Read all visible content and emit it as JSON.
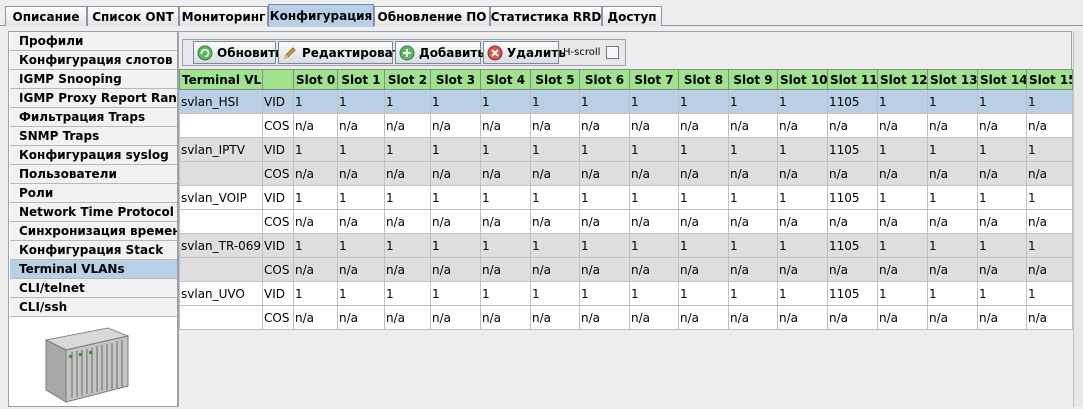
{
  "tabs": [
    {
      "label": "Описание",
      "active": false
    },
    {
      "label": "Список ONT",
      "active": false
    },
    {
      "label": "Мониторинг",
      "active": false
    },
    {
      "label": "Конфигурация",
      "active": true
    },
    {
      "label": "Обновление ПО",
      "active": false
    },
    {
      "label": "Статистика RRD",
      "active": false
    },
    {
      "label": "Доступ",
      "active": false
    }
  ],
  "sidebar": {
    "items": [
      {
        "label": "Профили"
      },
      {
        "label": "Конфигурация слотов"
      },
      {
        "label": "IGMP Snooping"
      },
      {
        "label": "IGMP Proxy Report Range"
      },
      {
        "label": "Фильтрация Traps"
      },
      {
        "label": "SNMP Traps"
      },
      {
        "label": "Конфигурация syslog"
      },
      {
        "label": "Пользователи"
      },
      {
        "label": "Роли"
      },
      {
        "label": "Network Time Protocol"
      },
      {
        "label": "Синхронизация времени"
      },
      {
        "label": "Конфигурация Stack"
      },
      {
        "label": "Terminal VLANs",
        "active": true
      },
      {
        "label": "CLI/telnet"
      },
      {
        "label": "CLI/ssh"
      }
    ],
    "device_icon": "chassis-device-icon"
  },
  "toolbar": {
    "refresh_label": "Обновить",
    "edit_label": "Редактировать",
    "add_label": "Добавить",
    "delete_label": "Удалить",
    "hscroll_label": "H-scroll",
    "hscroll_checked": false
  },
  "table": {
    "columns": [
      "Terminal VL...",
      "",
      "Slot 0",
      "Slot 1",
      "Slot 2",
      "Slot 3",
      "Slot 4",
      "Slot 5",
      "Slot 6",
      "Slot 7",
      "Slot 8",
      "Slot 9",
      "Slot 10",
      "Slot 11",
      "Slot 12",
      "Slot 13",
      "Slot 14",
      "Slot 15"
    ],
    "rows": [
      [
        "svlan_HSI",
        "VID",
        "1",
        "1",
        "1",
        "1",
        "1",
        "1",
        "1",
        "1",
        "1",
        "1",
        "1",
        "1105",
        "1",
        "1",
        "1",
        "1"
      ],
      [
        "",
        "COS",
        "n/a",
        "n/a",
        "n/a",
        "n/a",
        "n/a",
        "n/a",
        "n/a",
        "n/a",
        "n/a",
        "n/a",
        "n/a",
        "n/a",
        "n/a",
        "n/a",
        "n/a",
        "n/a"
      ],
      [
        "svlan_IPTV",
        "VID",
        "1",
        "1",
        "1",
        "1",
        "1",
        "1",
        "1",
        "1",
        "1",
        "1",
        "1",
        "1105",
        "1",
        "1",
        "1",
        "1"
      ],
      [
        "",
        "COS",
        "n/a",
        "n/a",
        "n/a",
        "n/a",
        "n/a",
        "n/a",
        "n/a",
        "n/a",
        "n/a",
        "n/a",
        "n/a",
        "n/a",
        "n/a",
        "n/a",
        "n/a",
        "n/a"
      ],
      [
        "svlan_VOIP",
        "VID",
        "1",
        "1",
        "1",
        "1",
        "1",
        "1",
        "1",
        "1",
        "1",
        "1",
        "1",
        "1105",
        "1",
        "1",
        "1",
        "1"
      ],
      [
        "",
        "COS",
        "n/a",
        "n/a",
        "n/a",
        "n/a",
        "n/a",
        "n/a",
        "n/a",
        "n/a",
        "n/a",
        "n/a",
        "n/a",
        "n/a",
        "n/a",
        "n/a",
        "n/a",
        "n/a"
      ],
      [
        "svlan_TR-069",
        "VID",
        "1",
        "1",
        "1",
        "1",
        "1",
        "1",
        "1",
        "1",
        "1",
        "1",
        "1",
        "1105",
        "1",
        "1",
        "1",
        "1"
      ],
      [
        "",
        "COS",
        "n/a",
        "n/a",
        "n/a",
        "n/a",
        "n/a",
        "n/a",
        "n/a",
        "n/a",
        "n/a",
        "n/a",
        "n/a",
        "n/a",
        "n/a",
        "n/a",
        "n/a",
        "n/a"
      ],
      [
        "svlan_UVO",
        "VID",
        "1",
        "1",
        "1",
        "1",
        "1",
        "1",
        "1",
        "1",
        "1",
        "1",
        "1",
        "1105",
        "1",
        "1",
        "1",
        "1"
      ],
      [
        "",
        "COS",
        "n/a",
        "n/a",
        "n/a",
        "n/a",
        "n/a",
        "n/a",
        "n/a",
        "n/a",
        "n/a",
        "n/a",
        "n/a",
        "n/a",
        "n/a",
        "n/a",
        "n/a",
        "n/a"
      ]
    ],
    "selected_row": 0
  },
  "colors": {
    "accent": "#b8cfe5",
    "header_green": "#9fe38f",
    "row_gray": "#dedede"
  }
}
